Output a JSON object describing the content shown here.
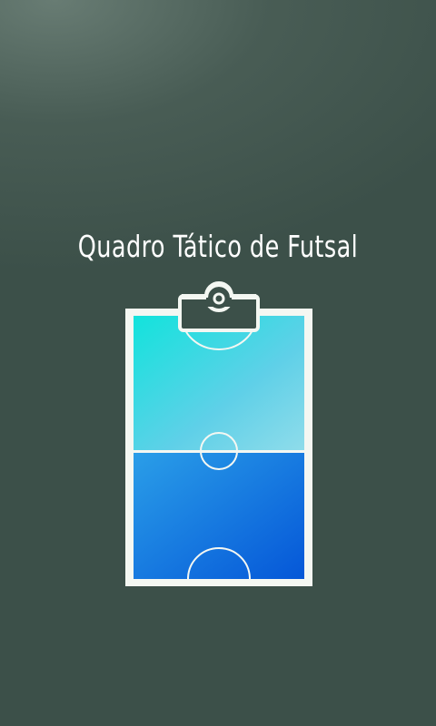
{
  "screen": {
    "title": "Quadro Tático de Futsal"
  },
  "logo": {
    "icon": "clipboard-futsal-court-icon",
    "court_gradient_start": "#1de0e0",
    "court_gradient_end": "#0559d6",
    "frame_color": "#f4f7f2"
  },
  "colors": {
    "background": "#3c5049",
    "text": "#ffffff"
  }
}
